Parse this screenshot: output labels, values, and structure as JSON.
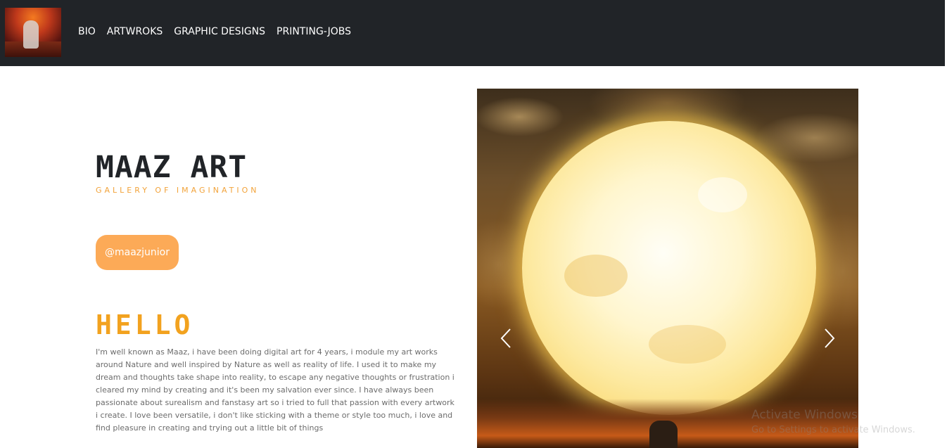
{
  "nav": {
    "logo_alt": "Maaz Art logo",
    "links": [
      {
        "label": "BIO"
      },
      {
        "label": "ARTWROKS"
      },
      {
        "label": "GRAPHIC DESIGNS"
      },
      {
        "label": "PRINTING-JOBS"
      }
    ]
  },
  "hero": {
    "title": "MAAZ ART",
    "subtitle": "GALLERY OF IMAGINATION",
    "handle_button": "@maazjunior"
  },
  "about": {
    "heading": "HELLO",
    "text": "I'm well known as Maaz, i have been doing digital art for 4 years, i module my art works around Nature and well inspired by Nature as well as reality of life. I used it to make my dream and thoughts take shape into reality, to escape any negative thoughts or frustration i cleared my mind by creating and it's been my salvation ever since. I have always been passionate about surealism and fanstasy art so i tried to full that passion with every artwork i create. I love been versatile, i don't like sticking with a theme or style too much, i love and find pleasure in creating and trying out a little bit of things"
  },
  "carousel": {
    "prev_icon": "chevron-left-icon",
    "next_icon": "chevron-right-icon"
  },
  "watermark": {
    "title": "Activate Windows",
    "subtitle": "Go to Settings to activate Windows."
  },
  "colors": {
    "navbar": "#212428",
    "accent": "#f2a21f",
    "button": "#fcaa57"
  }
}
